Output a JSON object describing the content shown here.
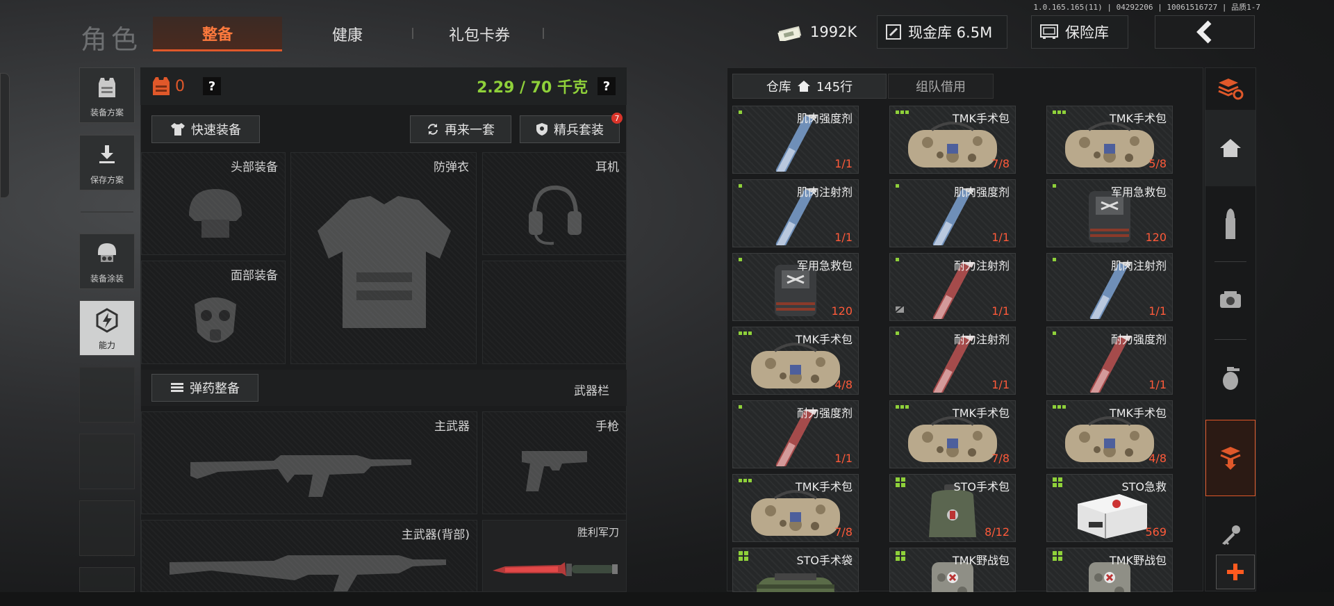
{
  "version": "1.0.165.165(11) | 04292206 | 10061516727 | 品质1-7",
  "header": {
    "title": "角色",
    "tabs": [
      {
        "label": "整备",
        "active": true
      },
      {
        "label": "健康",
        "active": false
      },
      {
        "label": "礼包卡券",
        "active": false
      }
    ],
    "currency": "1992K",
    "cash_vault": "现金库 6.5M",
    "safe_label": "保险库"
  },
  "sidebar": {
    "items": [
      {
        "label": "装备方案",
        "icon": "vest-icon"
      },
      {
        "label": "保存方案",
        "icon": "download-icon"
      },
      {
        "label": "装备涂装",
        "icon": "helmet-skin-icon"
      },
      {
        "label": "能力",
        "icon": "ability-icon"
      }
    ]
  },
  "equipment": {
    "armor_count": "0",
    "weight": "2.29 / 70 千克",
    "help": "?",
    "quick_equip": "快速装备",
    "again_label": "再来一套",
    "elite_label": "精兵套装",
    "elite_badge": "7",
    "slots": {
      "head": "头部装备",
      "vest": "防弹衣",
      "headset": "耳机",
      "face": "面部装备",
      "primary": "主武器",
      "pistol": "手枪",
      "primary_back": "主武器(背部)",
      "knife": "胜利军刀"
    },
    "ammo_label": "弹药整备",
    "weapon_bar": "武器栏"
  },
  "warehouse": {
    "tab_label": "仓库",
    "rows": "145行",
    "team_label": "组队借用",
    "items": [
      {
        "name": "肌肉强度剂",
        "count": "1/1",
        "type": "syringe-blue",
        "dots": 1
      },
      {
        "name": "TMK手术包",
        "count": "7/8",
        "type": "bag-camo",
        "dots": 3
      },
      {
        "name": "TMK手术包",
        "count": "5/8",
        "type": "bag-camo",
        "dots": 3
      },
      {
        "name": "肌肉注射剂",
        "count": "1/1",
        "type": "syringe-blue",
        "dots": 1
      },
      {
        "name": "肌肉强度剂",
        "count": "1/1",
        "type": "syringe-blue",
        "dots": 1
      },
      {
        "name": "军用急救包",
        "count": "120",
        "type": "backpack-dark",
        "dots": 1
      },
      {
        "name": "军用急救包",
        "count": "120",
        "type": "backpack-dark",
        "dots": 1
      },
      {
        "name": "耐力注射剂",
        "count": "1/1",
        "type": "syringe-red",
        "dots": 1
      },
      {
        "name": "肌肉注射剂",
        "count": "1/1",
        "type": "syringe-blue",
        "dots": 1
      },
      {
        "name": "TMK手术包",
        "count": "4/8",
        "type": "bag-camo",
        "dots": 3
      },
      {
        "name": "耐力注射剂",
        "count": "1/1",
        "type": "syringe-red",
        "dots": 1
      },
      {
        "name": "耐力强度剂",
        "count": "1/1",
        "type": "syringe-red",
        "dots": 1
      },
      {
        "name": "耐力强度剂",
        "count": "1/1",
        "type": "syringe-red",
        "dots": 1
      },
      {
        "name": "TMK手术包",
        "count": "7/8",
        "type": "bag-camo",
        "dots": 3
      },
      {
        "name": "TMK手术包",
        "count": "4/8",
        "type": "bag-camo",
        "dots": 3
      },
      {
        "name": "TMK手术包",
        "count": "7/8",
        "type": "bag-camo",
        "dots": 3
      },
      {
        "name": "STO手术包",
        "count": "8/12",
        "type": "pouch-green",
        "dots": 4
      },
      {
        "name": "STO急救",
        "count": "569",
        "type": "case-white",
        "dots": 4
      },
      {
        "name": "STO手术袋",
        "count": "",
        "type": "roll-green",
        "dots": 4
      },
      {
        "name": "TMK野战包",
        "count": "",
        "type": "backpack-camo",
        "dots": 4
      },
      {
        "name": "TMK野战包",
        "count": "",
        "type": "backpack-camo",
        "dots": 4
      }
    ]
  },
  "rail": {
    "icons": [
      "stack-refresh-icon",
      "home-icon",
      "ammo-icon",
      "scope-icon",
      "grenade-icon",
      "medkit-download-icon",
      "key-icon",
      "plus-icon"
    ]
  },
  "colors": {
    "accent": "#e0582a",
    "green": "#8fd13a",
    "count_red": "#ff5a3a"
  }
}
